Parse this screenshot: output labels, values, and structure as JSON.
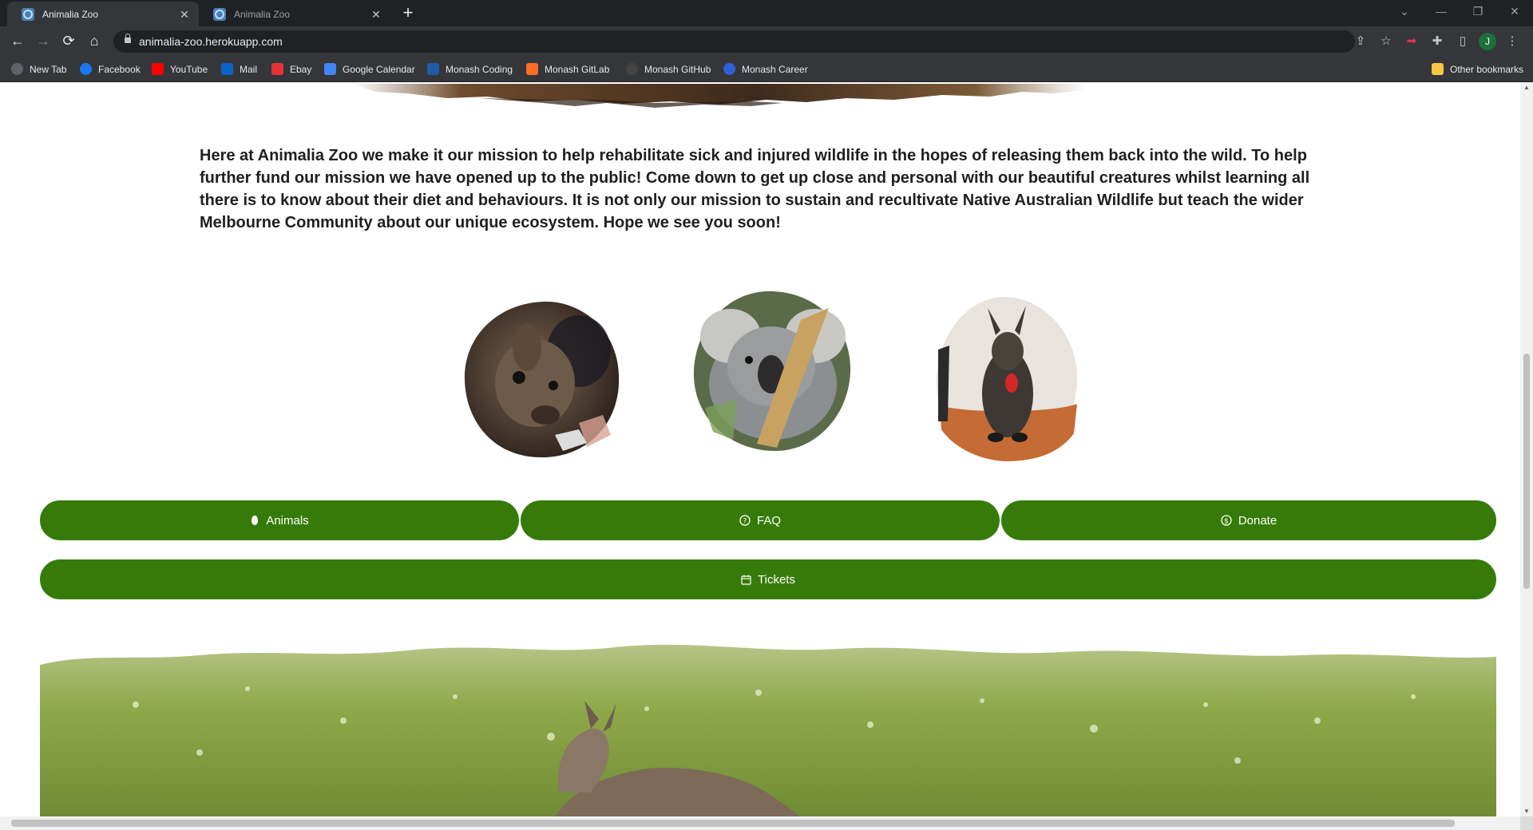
{
  "browser": {
    "tabs": [
      {
        "title": "Animalia Zoo",
        "active": true
      },
      {
        "title": "Animalia Zoo",
        "active": false
      }
    ],
    "url": "animalia-zoo.herokuapp.com",
    "profile_initial": "J",
    "bookmarks": [
      {
        "label": "New Tab",
        "icon": "globe-icon",
        "color": "#5f6368"
      },
      {
        "label": "Facebook",
        "icon": "facebook-icon",
        "color": "#1877f2"
      },
      {
        "label": "YouTube",
        "icon": "youtube-icon",
        "color": "#ff0000"
      },
      {
        "label": "Mail",
        "icon": "outlook-icon",
        "color": "#0a64c4"
      },
      {
        "label": "Ebay",
        "icon": "ebay-icon",
        "color": "#e53238"
      },
      {
        "label": "Google Calendar",
        "icon": "calendar-icon",
        "color": "#4285f4"
      },
      {
        "label": "Monash Coding",
        "icon": "monash-icon",
        "color": "#1f5aa6"
      },
      {
        "label": "Monash  GitLab",
        "icon": "gitlab-icon",
        "color": "#fc6d26"
      },
      {
        "label": "Monash GitHub",
        "icon": "github-icon",
        "color": "#444444"
      },
      {
        "label": "Monash Career",
        "icon": "career-icon",
        "color": "#2c62d8"
      }
    ],
    "other_bookmarks": "Other bookmarks"
  },
  "page": {
    "mission_text": "Here at Animalia Zoo we make it our mission to help rehabilitate sick and injured wildlife in the hopes of releasing them back into the wild. To help further fund our mission we have opened up to the public! Come down to get up close and personal with our beautiful creatures whilst learning all there is to know about their diet and behaviours. It is not only our mission to sustain and recultivate Native Australian Wildlife but teach the wider Melbourne Community about our unique ecosystem. Hope we see you soon!",
    "nav_buttons": {
      "animals": "Animals",
      "faq": "FAQ",
      "donate": "Donate",
      "tickets": "Tickets"
    },
    "accent_color": "#367b09"
  }
}
